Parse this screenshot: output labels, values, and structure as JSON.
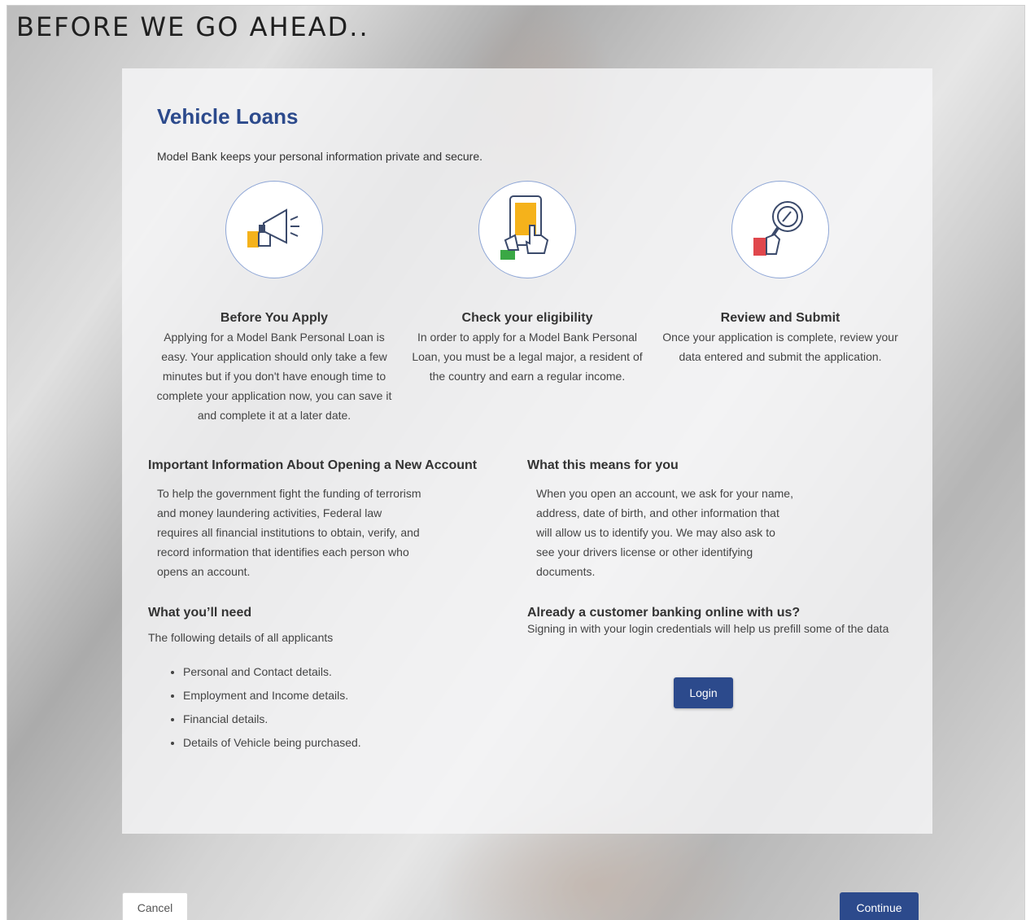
{
  "page": {
    "heading": "BEFORE WE GO AHEAD.."
  },
  "card": {
    "title": "Vehicle Loans",
    "intro": "Model Bank keeps your personal information private and secure."
  },
  "steps": [
    {
      "icon": "megaphone-icon",
      "title": "Before You Apply",
      "description": "Applying for a Model Bank Personal Loan is easy. Your application should only take a few minutes but if you don't have enough time to complete your application now, you can save it and complete it at a later date."
    },
    {
      "icon": "tablet-tap-icon",
      "title": "Check your eligibility",
      "description": "In order to apply for a Model Bank Personal Loan, you must be a legal major, a resident of the country and earn a regular income."
    },
    {
      "icon": "magnifier-icon",
      "title": "Review and Submit",
      "description": "Once your application is complete, review your data entered and submit the application."
    }
  ],
  "important": {
    "title": "Important Information About Opening a New Account",
    "body": "To help the government fight the funding of terrorism and money laundering activities, Federal law requires all financial institutions to obtain, verify, and record information that identifies each person who opens an account."
  },
  "means": {
    "title": "What this means for you",
    "body": "When you open an account, we ask for your name, address, date of birth, and other information that will allow us to identify you. We may also ask to see your drivers license or other identifying documents."
  },
  "needs": {
    "title": "What you’ll need",
    "subtitle": "The following details of all applicants",
    "items": [
      "Personal and Contact details.",
      "Employment and Income details.",
      "Financial details.",
      "Details of Vehicle being purchased."
    ]
  },
  "existing": {
    "title": "Already a customer banking online with us?",
    "body": "Signing in with your login credentials will help us prefill some of the data",
    "login_label": "Login"
  },
  "footer": {
    "cancel_label": "Cancel",
    "continue_label": "Continue"
  },
  "colors": {
    "brand": "#2c4a8c",
    "icon_yellow": "#f5b21b",
    "icon_green": "#3aa845",
    "icon_red": "#e0474c"
  }
}
